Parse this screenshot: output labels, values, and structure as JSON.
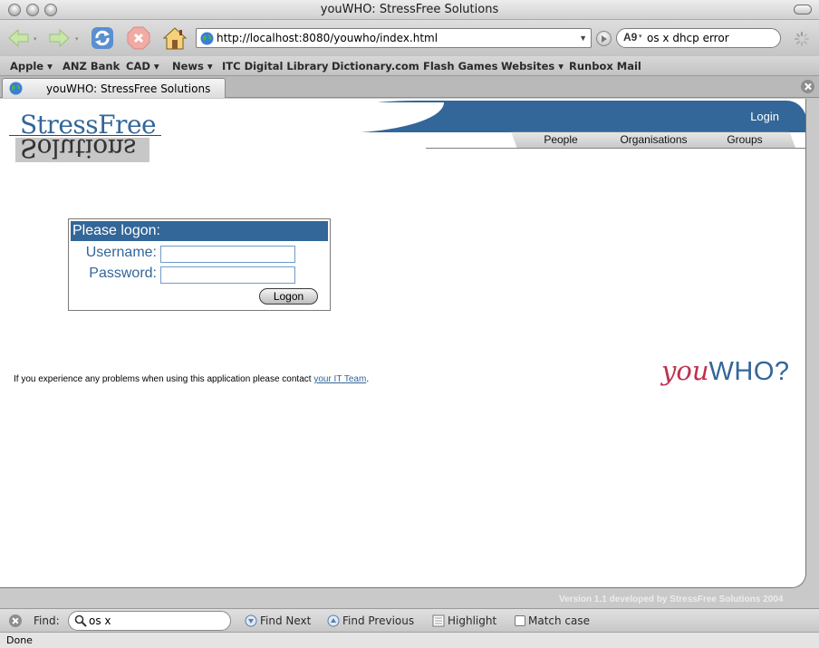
{
  "window": {
    "title": "youWHO: StressFree Solutions"
  },
  "toolbar": {
    "url": "http://localhost:8080/youwho/index.html",
    "search_engine": "A9",
    "search_query": "os x dhcp error"
  },
  "bookmarks": [
    {
      "label": "Apple",
      "menu": true
    },
    {
      "label": "ANZ Bank",
      "menu": false
    },
    {
      "label": "CAD",
      "menu": true
    },
    {
      "label": "News",
      "menu": true
    },
    {
      "label": "ITC Digital Library",
      "menu": false
    },
    {
      "label": "Dictionary.com",
      "menu": false
    },
    {
      "label": "Flash Games",
      "menu": false
    },
    {
      "label": "Websites",
      "menu": true
    },
    {
      "label": "Runbox Mail",
      "menu": false
    }
  ],
  "bookmark_labels": [
    "Apple ▾",
    "ANZ Bank",
    "CAD ▾",
    "News ▾",
    "ITC Digital Library",
    "Dictionary.com",
    "Flash Games",
    "Websites ▾",
    "Runbox Mail"
  ],
  "tab": {
    "label": "youWHO: StressFree Solutions"
  },
  "site": {
    "logo_top": "StressFree",
    "logo_bottom": "Solutions",
    "login_link": "Login",
    "nav": [
      "People",
      "Organisations",
      "Groups"
    ],
    "brand_you": "you",
    "brand_who": "WHO?"
  },
  "login": {
    "heading": "Please logon:",
    "username_label": "Username:",
    "password_label": "Password:",
    "username_value": "",
    "password_value": "",
    "button": "Logon"
  },
  "help": {
    "text": "If you experience any problems when using this application please contact ",
    "link": "your IT Team",
    "suffix": "."
  },
  "footer": {
    "version": "Version 1.1 developed by StressFree Solutions 2004"
  },
  "findbar": {
    "label": "Find:",
    "value": "os x",
    "find_next": "Find Next",
    "find_previous": "Find Previous",
    "highlight": "Highlight",
    "match_case": "Match case"
  },
  "status": {
    "text": "Done"
  },
  "colors": {
    "brand_blue": "#336699",
    "brand_red": "#c0304e"
  }
}
